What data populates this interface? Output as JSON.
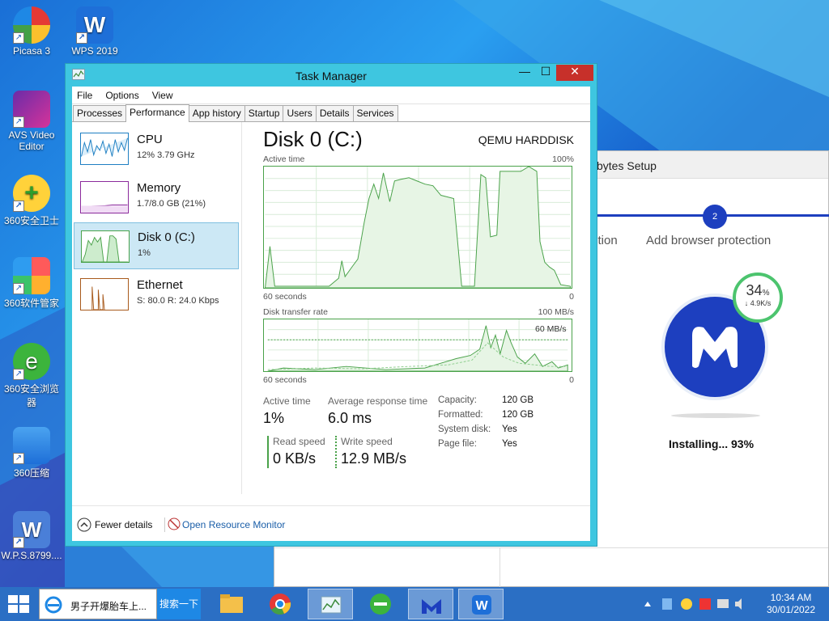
{
  "desktop": {
    "icons": [
      {
        "label": "Picasa 3"
      },
      {
        "label": "WPS 2019"
      },
      {
        "label": "AVS Video Editor"
      },
      {
        "label": "360安全卫士"
      },
      {
        "label": "360软件管家"
      },
      {
        "label": "360安全浏览器"
      },
      {
        "label": "360压缩"
      },
      {
        "label": "W.P.S.8799...."
      }
    ]
  },
  "installer": {
    "title": "bytes Setup",
    "step_number": "2",
    "step_prev_partial": "ction",
    "step_label": "Add browser protection",
    "progress_percent": "34",
    "progress_percent_sign": "%",
    "progress_speed": "↓ 4.9K/s",
    "status": "Installing... 93%"
  },
  "taskmanager": {
    "title": "Task Manager",
    "menu": [
      "File",
      "Options",
      "View"
    ],
    "tabs": [
      "Processes",
      "Performance",
      "App history",
      "Startup",
      "Users",
      "Details",
      "Services"
    ],
    "active_tab": "Performance",
    "sidebar": [
      {
        "name": "CPU",
        "sub": "12%  3.79 GHz",
        "color": "#1e7fc2"
      },
      {
        "name": "Memory",
        "sub": "1.7/8.0 GB (21%)",
        "color": "#8b2a9c"
      },
      {
        "name": "Disk 0 (C:)",
        "sub": "1%",
        "color": "#4aa24a"
      },
      {
        "name": "Ethernet",
        "sub": "S: 80.0  R: 24.0 Kbps",
        "color": "#a85a1c"
      }
    ],
    "panel": {
      "title": "Disk 0 (C:)",
      "model": "QEMU HARDDISK",
      "active_time_label": "Active time",
      "active_time_max": "100%",
      "axis_seconds": "60 seconds",
      "axis_zero": "0",
      "transfer_label": "Disk transfer rate",
      "transfer_max": "100 MB/s",
      "transfer_mark": "60 MB/s",
      "stats": {
        "active_time_label": "Active time",
        "active_time_value": "1%",
        "avg_response_label": "Average response time",
        "avg_response_value": "6.0 ms",
        "read_label": "Read speed",
        "read_value": "0 KB/s",
        "write_label": "Write speed",
        "write_value": "12.9 MB/s"
      },
      "props": [
        {
          "k": "Capacity:",
          "v": "120 GB"
        },
        {
          "k": "Formatted:",
          "v": "120 GB"
        },
        {
          "k": "System disk:",
          "v": "Yes"
        },
        {
          "k": "Page file:",
          "v": "Yes"
        }
      ]
    },
    "footer": {
      "fewer_details": "Fewer details",
      "open_resource_monitor": "Open Resource Monitor"
    }
  },
  "taskbar": {
    "ie_label": "男子开爆胎车上...",
    "search_label": "搜索一下",
    "time": "10:34 AM",
    "date": "30/01/2022"
  },
  "colors": {
    "disk_green": "#4aa24a",
    "accent_blue": "#1d3fbf",
    "tm_frame": "#3ec6e0"
  }
}
